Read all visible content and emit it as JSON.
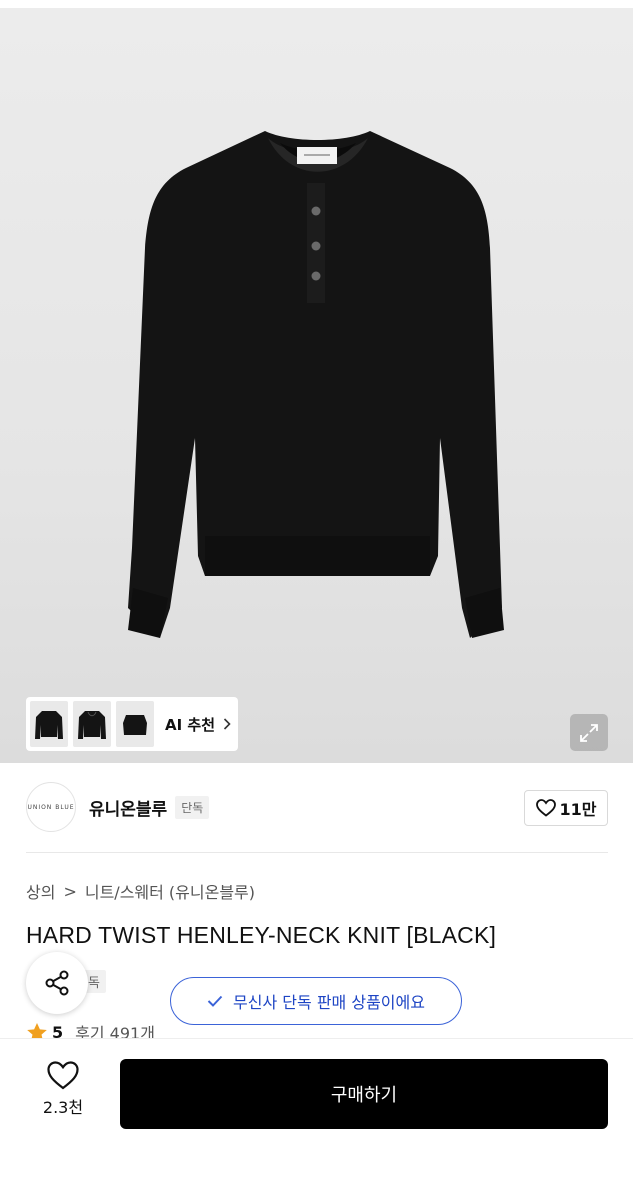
{
  "gallery": {
    "ai_recommend_label": "AI 추천",
    "thumbnails": [
      "thumb-1",
      "thumb-2",
      "thumb-3"
    ]
  },
  "brand": {
    "logo_text": "UNION BLUE",
    "name": "유니온블루",
    "exclusive_tag": "단독",
    "like_count": "11만"
  },
  "breadcrumb": {
    "category": "상의",
    "separator": ">",
    "subcategory": "니트/스웨터 (유니온블루)"
  },
  "product": {
    "title": "HARD TWIST HENLEY-NECK KNIT [BLACK]",
    "tag": "단독",
    "rating": "5",
    "review_text": "후기 491개"
  },
  "toast": {
    "message": "무신사 단독 판매 상품이에요"
  },
  "bottom_bar": {
    "wish_count": "2.3천",
    "buy_label": "구매하기"
  },
  "colors": {
    "accent_blue": "#3b63d8",
    "star": "#f0a020",
    "buy_button": "#000000"
  },
  "icons": [
    "expand-icon",
    "heart-icon",
    "share-icon",
    "check-icon",
    "star-icon",
    "chevron-right-icon"
  ]
}
